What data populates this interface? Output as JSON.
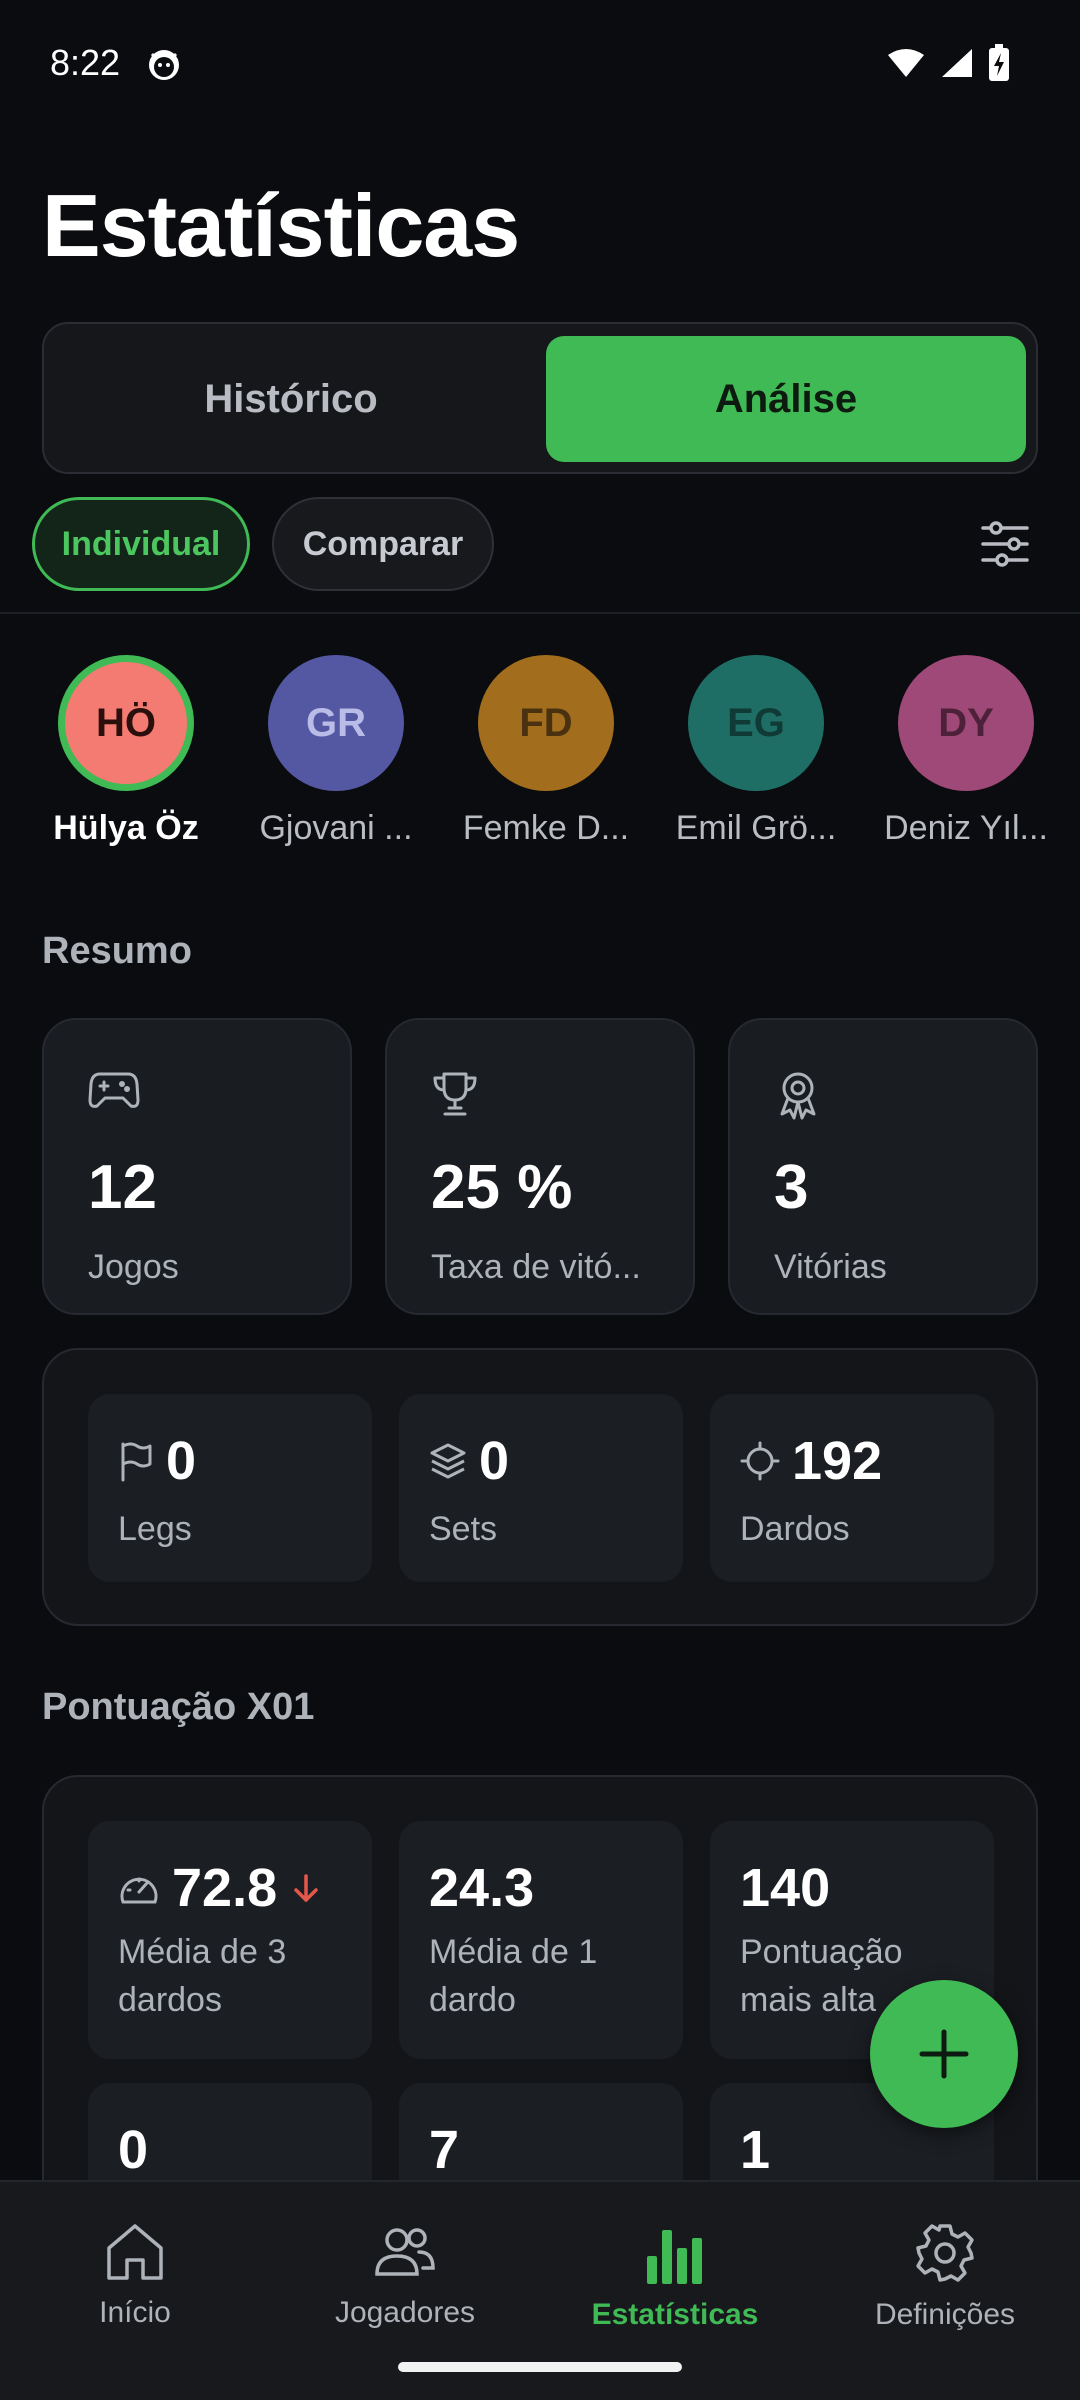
{
  "status_bar": {
    "time": "8:22"
  },
  "page_title": "Estatísticas",
  "segments": {
    "history": "Histórico",
    "analysis": "Análise"
  },
  "chips": {
    "individual": "Individual",
    "compare": "Comparar"
  },
  "players": [
    {
      "initials": "HÖ",
      "name": "Hülya Öz",
      "color": "#f47b72",
      "text_color": "#2a0f0c",
      "selected": true
    },
    {
      "initials": "GR",
      "name": "Gjovani ...",
      "color": "#5458a3",
      "text_color": "#b9bce6"
    },
    {
      "initials": "FD",
      "name": "Femke D...",
      "color": "#a36d1e",
      "text_color": "#4a3210"
    },
    {
      "initials": "EG",
      "name": "Emil Grö...",
      "color": "#1f6e66",
      "text_color": "#0f3a35"
    },
    {
      "initials": "DY",
      "name": "Deniz Yıl...",
      "color": "#9e4977",
      "text_color": "#4d2139"
    }
  ],
  "summary": {
    "title": "Resumo",
    "cards": [
      {
        "icon": "gamepad-icon",
        "value": "12",
        "label": "Jogos"
      },
      {
        "icon": "trophy-icon",
        "value": "25 %",
        "label": "Taxa de vitó..."
      },
      {
        "icon": "medal-icon",
        "value": "3",
        "label": "Vitórias"
      }
    ],
    "tiles": [
      {
        "icon": "flag-icon",
        "value": "0",
        "label": "Legs"
      },
      {
        "icon": "layers-icon",
        "value": "0",
        "label": "Sets"
      },
      {
        "icon": "crosshair-icon",
        "value": "192",
        "label": "Dardos"
      }
    ]
  },
  "x01": {
    "title": "Pontuação X01",
    "tiles": [
      {
        "icon": "gauge-icon",
        "value": "72.8",
        "trend": "arrow-down-icon",
        "label_line1": "Média de 3",
        "label_line2": "dardos"
      },
      {
        "value": "24.3",
        "label_line1": "Média de 1",
        "label_line2": "dardo"
      },
      {
        "value": "140",
        "label_line1": "Pontuação",
        "label_line2": "mais alta"
      },
      {
        "value": "0"
      },
      {
        "value": "7"
      },
      {
        "value": "1"
      }
    ]
  },
  "bottom_nav": [
    {
      "icon": "home-icon",
      "label": "Início"
    },
    {
      "icon": "players-icon",
      "label": "Jogadores"
    },
    {
      "icon": "stats-icon",
      "label": "Estatísticas",
      "active": true
    },
    {
      "icon": "settings-icon",
      "label": "Definições"
    }
  ],
  "colors": {
    "accent": "#3fba54",
    "background": "#0b0c0f",
    "trend_down": "#e5574b"
  }
}
